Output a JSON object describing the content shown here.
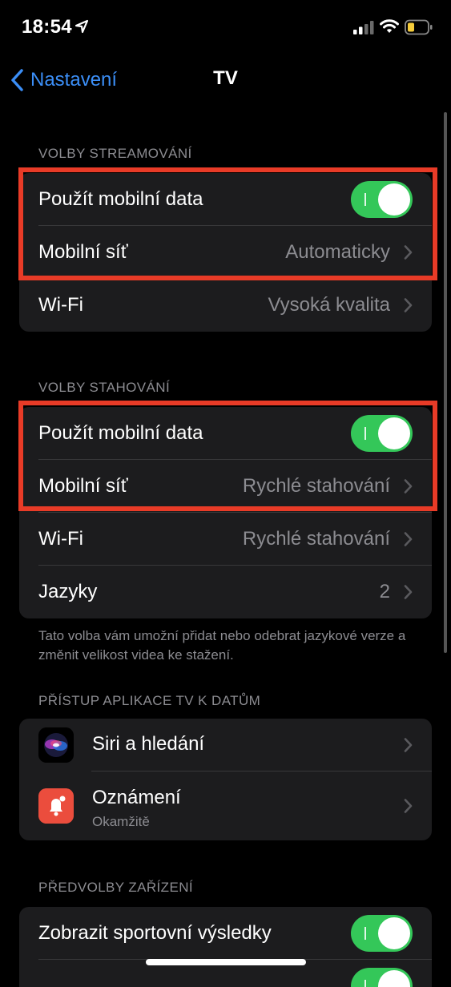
{
  "status_bar": {
    "time": "18:54"
  },
  "nav": {
    "back_label": "Nastavení",
    "title": "TV"
  },
  "streaming": {
    "header": "VOLBY STREAMOVÁNÍ",
    "rows": [
      {
        "label": "Použít mobilní data",
        "toggle": true
      },
      {
        "label": "Mobilní síť",
        "value": "Automaticky"
      },
      {
        "label": "Wi-Fi",
        "value": "Vysoká kvalita"
      }
    ]
  },
  "download": {
    "header": "VOLBY STAHOVÁNÍ",
    "rows": [
      {
        "label": "Použít mobilní data",
        "toggle": true
      },
      {
        "label": "Mobilní síť",
        "value": "Rychlé stahování"
      },
      {
        "label": "Wi-Fi",
        "value": "Rychlé stahování"
      },
      {
        "label": "Jazyky",
        "value": "2"
      }
    ],
    "footer": "Tato volba vám umožní přidat nebo odebrat jazykové verze a změnit velikost videa ke stažení."
  },
  "access": {
    "header": "PŘÍSTUP APLIKACE TV K DATŮM",
    "rows": [
      {
        "label": "Siri a hledání",
        "icon": "siri-icon"
      },
      {
        "label": "Oznámení",
        "sub": "Okamžitě",
        "icon": "notification-bell-icon"
      }
    ]
  },
  "device": {
    "header": "PŘEDVOLBY ZAŘÍZENÍ",
    "rows": [
      {
        "label": "Zobrazit sportovní výsledky",
        "toggle": true
      }
    ]
  },
  "colors": {
    "accent": "#3b8ef6",
    "toggle_on": "#34c759",
    "highlight": "#e83b27",
    "cell_bg": "#1c1c1e"
  }
}
